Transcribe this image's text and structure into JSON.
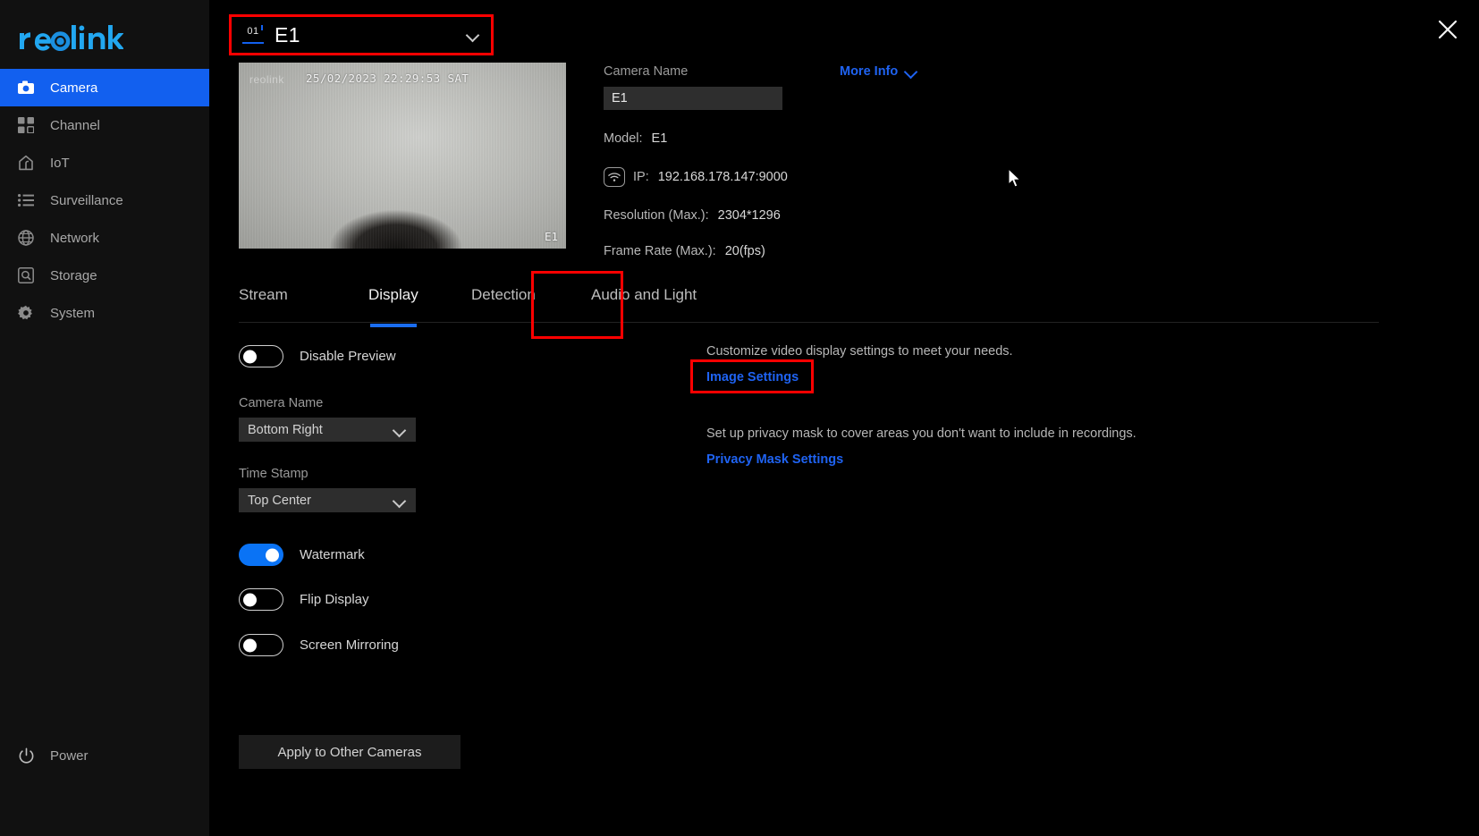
{
  "sidebar": {
    "logo_text": "reolink",
    "items": [
      {
        "label": "Camera",
        "icon": "camera-icon",
        "active": true
      },
      {
        "label": "Channel",
        "icon": "grid-icon",
        "active": false
      },
      {
        "label": "IoT",
        "icon": "home-icon",
        "active": false
      },
      {
        "label": "Surveillance",
        "icon": "list-icon",
        "active": false
      },
      {
        "label": "Network",
        "icon": "globe-icon",
        "active": false
      },
      {
        "label": "Storage",
        "icon": "hard-drive-icon",
        "active": false
      },
      {
        "label": "System",
        "icon": "gear-icon",
        "active": false
      }
    ],
    "power_label": "Power",
    "power_icon": "power-icon"
  },
  "header": {
    "channel_number": "01",
    "camera_title": "E1",
    "dropdown_icon": "chevron-down-icon",
    "close_icon": "close-icon",
    "highlight_color": "#fe0000"
  },
  "preview": {
    "watermark_logo": "reolink",
    "timestamp": "25/02/2023 22:29:53 SAT",
    "camera_name_osd": "E1"
  },
  "info": {
    "camera_name_label": "Camera Name",
    "camera_name_value": "E1",
    "camera_name_placeholder": "Camera Name",
    "more_info_label": "More Info",
    "more_info_icon": "chevron-down-icon",
    "wifi_icon": "wifi-icon",
    "specs": [
      {
        "key": "Model:",
        "value": "E1"
      },
      {
        "key": "IP:",
        "value": "192.168.178.147:9000"
      },
      {
        "key": "Resolution (Max.):",
        "value": "2304*1296"
      },
      {
        "key": "Frame Rate (Max.):",
        "value": "20(fps)"
      }
    ]
  },
  "tabs": [
    {
      "label": "Stream",
      "active": false
    },
    {
      "label": "Display",
      "active": true
    },
    {
      "label": "Detection",
      "active": false
    },
    {
      "label": "Audio and Light",
      "active": false
    }
  ],
  "display_settings": {
    "disable_preview": {
      "label": "Disable Preview",
      "on": false
    },
    "camera_name": {
      "label": "Camera Name",
      "value": "Bottom Right",
      "icon": "chevron-down-icon"
    },
    "time_stamp": {
      "label": "Time Stamp",
      "value": "Top Center",
      "icon": "chevron-down-icon"
    },
    "watermark": {
      "label": "Watermark",
      "on": true
    },
    "flip_display": {
      "label": "Flip Display",
      "on": false
    },
    "screen_mirroring": {
      "label": "Screen Mirroring",
      "on": false
    }
  },
  "right_panel": {
    "image_desc": "Customize video display settings to meet your needs.",
    "image_link": "Image Settings",
    "privacy_desc": "Set up privacy mask to cover areas you don't want to include in recordings.",
    "privacy_link": "Privacy Mask Settings"
  },
  "footer": {
    "apply_label": "Apply to Other Cameras"
  },
  "colors": {
    "accent_blue": "#1260ef",
    "link_blue": "#1f63f2",
    "toggle_on": "#0a73f5",
    "highlight_red": "#fe0000",
    "sidebar_bg": "#111111"
  }
}
